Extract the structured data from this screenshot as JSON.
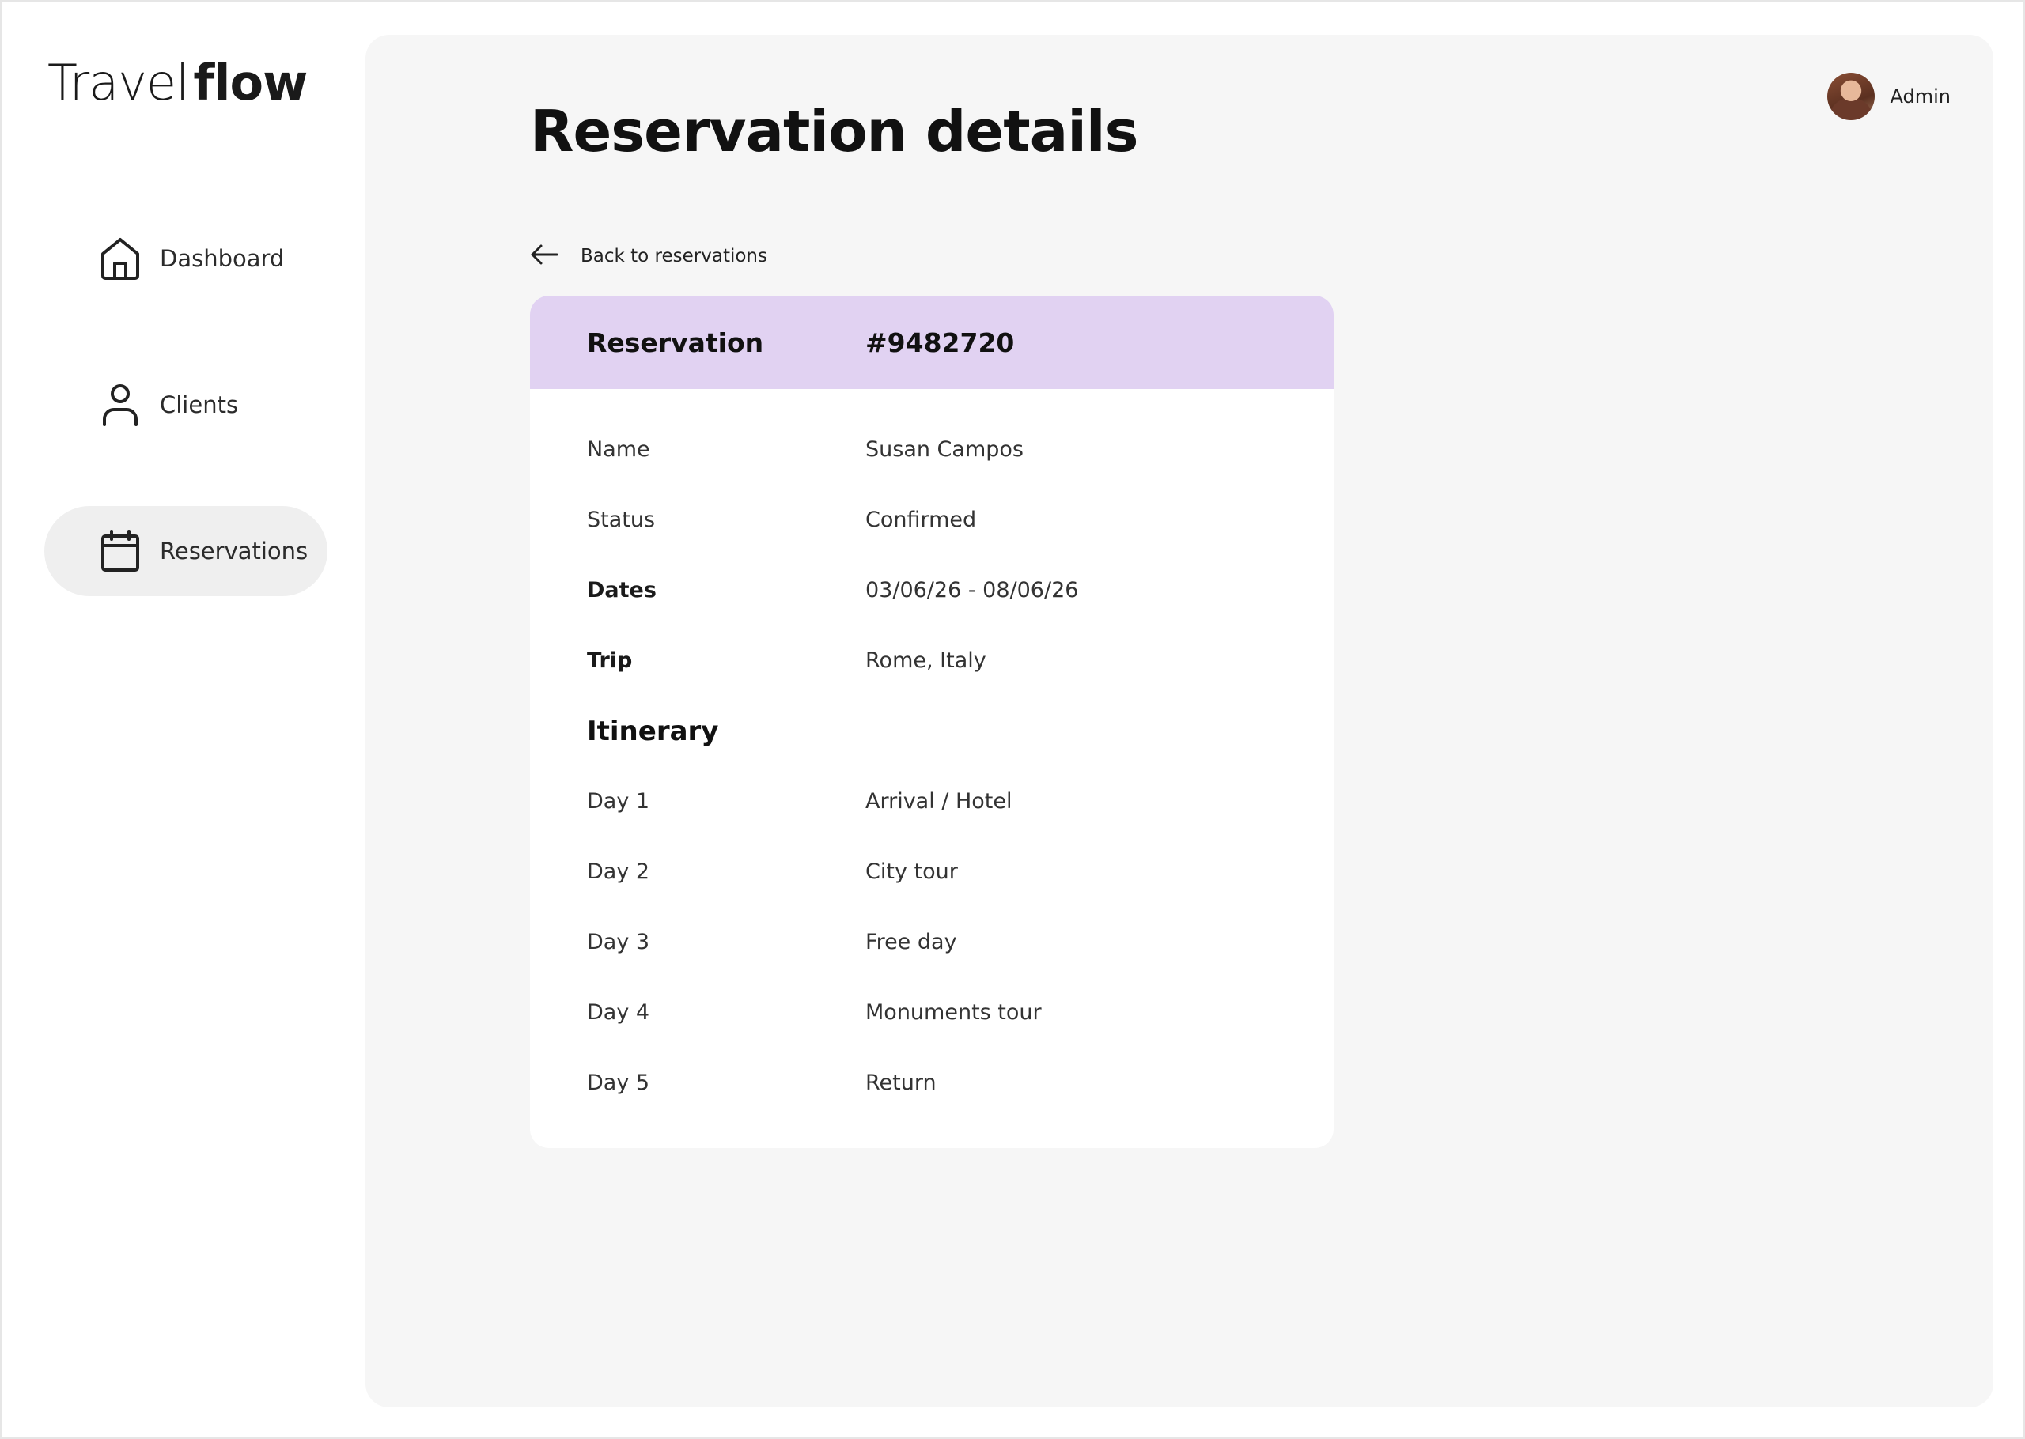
{
  "app": {
    "logo_light": "Travel",
    "logo_bold": "flow"
  },
  "sidebar": {
    "items": [
      {
        "label": "Dashboard",
        "icon": "home-icon",
        "active": false
      },
      {
        "label": "Clients",
        "icon": "user-icon",
        "active": false
      },
      {
        "label": "Reservations",
        "icon": "calendar-icon",
        "active": true
      }
    ]
  },
  "header": {
    "user_name": "Admin",
    "title": "Reservation details",
    "back_label": "Back to reservations"
  },
  "reservation": {
    "header_label": "Reservation",
    "number": "#9482720",
    "fields": [
      {
        "label": "Name",
        "value": "Susan Campos"
      },
      {
        "label": "Status",
        "value": "Confirmed"
      },
      {
        "label": "Dates",
        "value": "03/06/26 - 08/06/26"
      },
      {
        "label": "Trip",
        "value": "Rome, Italy"
      }
    ],
    "itinerary_title": "Itinerary",
    "itinerary": [
      {
        "day": "Day 1",
        "activity": "Arrival / Hotel"
      },
      {
        "day": "Day 2",
        "activity": "City tour"
      },
      {
        "day": "Day 3",
        "activity": "Free day"
      },
      {
        "day": "Day 4",
        "activity": "Monuments tour"
      },
      {
        "day": "Day 5",
        "activity": "Return"
      }
    ]
  },
  "colors": {
    "accent": "#e1d2f2",
    "panel": "#f6f6f6",
    "active_nav": "#efefef"
  }
}
